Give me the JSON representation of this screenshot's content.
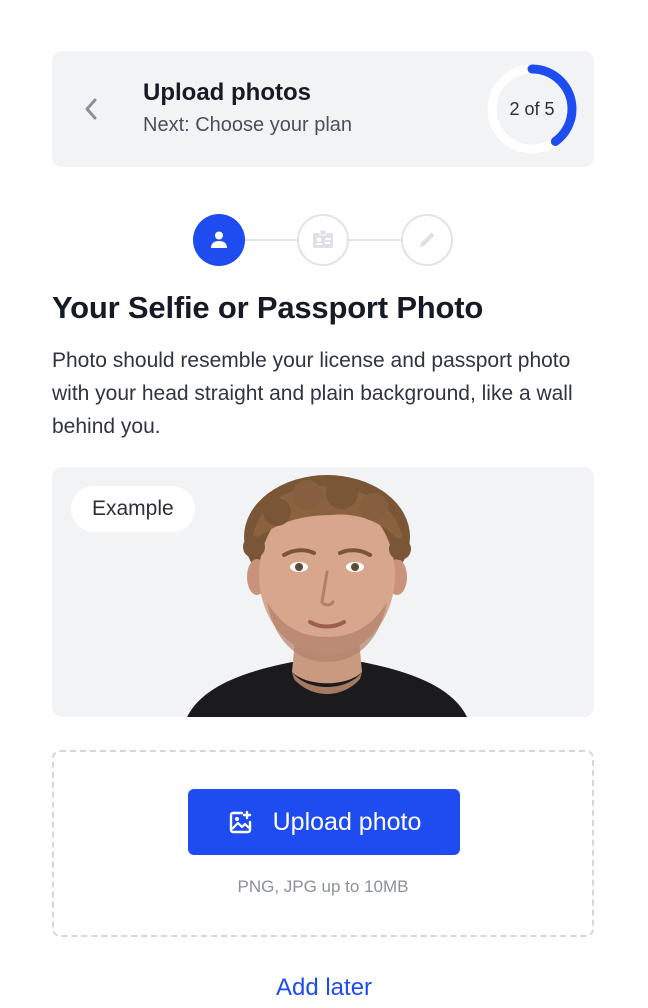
{
  "header": {
    "title": "Upload photos",
    "subtitle": "Next: Choose your plan",
    "progress_label": "2 of 5",
    "progress_fraction": 0.4
  },
  "steps": [
    {
      "icon": "person-icon",
      "state": "active"
    },
    {
      "icon": "id-card-icon",
      "state": "inactive"
    },
    {
      "icon": "pencil-icon",
      "state": "inactive"
    }
  ],
  "section": {
    "title": "Your Selfie or Passport Photo",
    "description": "Photo should resemble your license and passport photo with your head straight and plain background, like a wall behind you."
  },
  "example": {
    "badge": "Example"
  },
  "upload": {
    "button_label": "Upload photo",
    "button_icon": "image-add-icon",
    "hint": "PNG, JPG up to 10MB"
  },
  "footer": {
    "add_later": "Add later"
  },
  "colors": {
    "accent": "#1f4cf0",
    "card_bg": "#f2f3f5",
    "ring_track": "#ffffff"
  }
}
